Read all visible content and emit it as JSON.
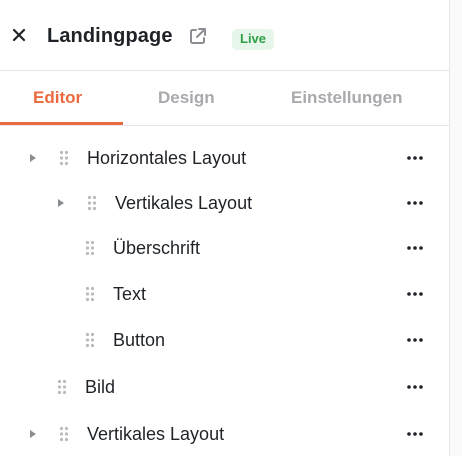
{
  "header": {
    "title": "Landingpage",
    "badge": "Live",
    "close_icon": "close-icon",
    "external_icon": "external-link-icon"
  },
  "tabs": [
    {
      "label": "Editor",
      "active": true
    },
    {
      "label": "Design",
      "active": false
    },
    {
      "label": "Einstellungen",
      "active": false
    }
  ],
  "tree": [
    {
      "label": "Horizontales Layout",
      "level": 0,
      "has_children": true
    },
    {
      "label": "Vertikales Layout",
      "level": 1,
      "has_children": true
    },
    {
      "label": "Überschrift",
      "level": 2,
      "has_children": false
    },
    {
      "label": "Text",
      "level": 2,
      "has_children": false
    },
    {
      "label": "Button",
      "level": 2,
      "has_children": false
    },
    {
      "label": "Bild",
      "level": 1,
      "has_children": false
    },
    {
      "label": "Vertikales Layout",
      "level": 0,
      "has_children": true
    }
  ],
  "colors": {
    "accent": "#ec6a3f",
    "badge_bg": "#e7f6ea",
    "badge_text": "#2f9e44",
    "muted_tab": "#a8aaad"
  }
}
